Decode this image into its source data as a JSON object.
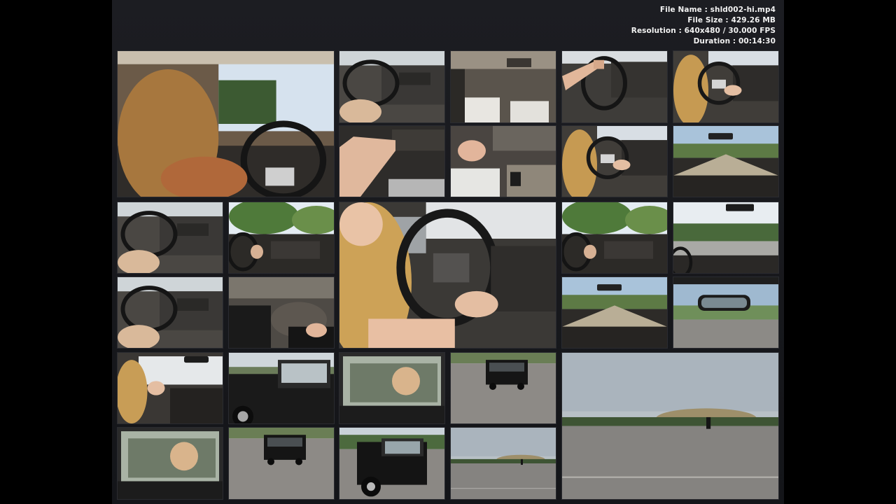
{
  "file_info": {
    "file_name": "File Name : shld002-hi.mp4",
    "file_size": "File Size : 429.26 MB",
    "resolution": "Resolution : 640x480 / 30.000 FPS",
    "duration": "Duration : 00:14:30"
  },
  "colors": {
    "page_background": "#000000",
    "sheet_background": "#1a1b20",
    "info_text": "#f2f2f2",
    "dashboard": "#3a3836",
    "road": "#7d7b78",
    "sky": "#cfd8e3",
    "trees": "#3f5a30",
    "truck": "#151515"
  },
  "thumbnails": [
    {
      "scene": "driver-wide"
    },
    {
      "scene": "dash-wheel"
    },
    {
      "scene": "interior-seats"
    },
    {
      "scene": "arm-wheel"
    },
    {
      "scene": "driver-wheel"
    },
    {
      "scene": "hand-dash"
    },
    {
      "scene": "seat-pedals"
    },
    {
      "scene": "driver-wheel"
    },
    {
      "scene": "windshield-road"
    },
    {
      "scene": "dash-wheel"
    },
    {
      "scene": "trees-dash"
    },
    {
      "scene": "driver-big"
    },
    {
      "scene": "trees-dash"
    },
    {
      "scene": "windshield-trees"
    },
    {
      "scene": "dash-wheel"
    },
    {
      "scene": "floor-feet"
    },
    {
      "scene": "windshield-road"
    },
    {
      "scene": "mirror-sky"
    },
    {
      "scene": "driver-side"
    },
    {
      "scene": "truck-side"
    },
    {
      "scene": "truck-window"
    },
    {
      "scene": "truck-lot"
    },
    {
      "scene": "parking-lot-wide"
    },
    {
      "scene": "truck-window"
    },
    {
      "scene": "truck-lot"
    },
    {
      "scene": "truck-front"
    },
    {
      "scene": "parking-lot-wide"
    }
  ]
}
